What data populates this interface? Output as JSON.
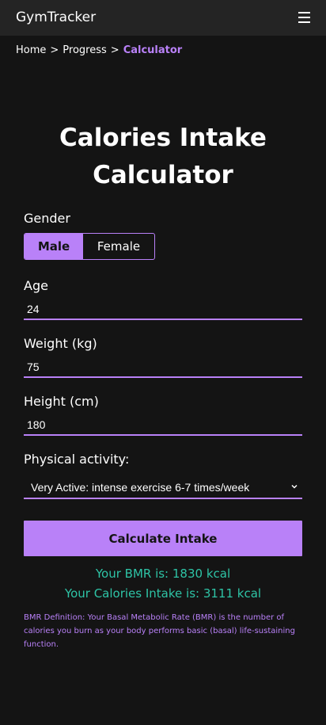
{
  "header": {
    "brand": "GymTracker",
    "menu_icon": "hamburger-icon"
  },
  "breadcrumb": {
    "items": [
      "Home",
      "Progress",
      "Calculator"
    ],
    "separator": ">"
  },
  "page": {
    "title_line1": "Calories Intake",
    "title_line2": "Calculator"
  },
  "form": {
    "gender": {
      "label": "Gender",
      "options": [
        "Male",
        "Female"
      ],
      "selected": "Male"
    },
    "age": {
      "label": "Age",
      "value": "24"
    },
    "weight": {
      "label": "Weight (kg)",
      "value": "75"
    },
    "height": {
      "label": "Height (cm)",
      "value": "180"
    },
    "activity": {
      "label": "Physical activity:",
      "selected": "Very Active: intense exercise 6-7 times/week"
    },
    "submit_label": "Calculate Intake"
  },
  "results": {
    "bmr": "Your BMR is: 1830 kcal",
    "intake": "Your Calories Intake is: 3111 kcal"
  },
  "note": "BMR Definition: Your Basal Metabolic Rate (BMR) is the number of calories you burn as your body performs basic (basal) life-sustaining function.",
  "colors": {
    "accent": "#b981f8",
    "result": "#2ec4a6",
    "background": "#141414",
    "topbar": "#242424"
  }
}
